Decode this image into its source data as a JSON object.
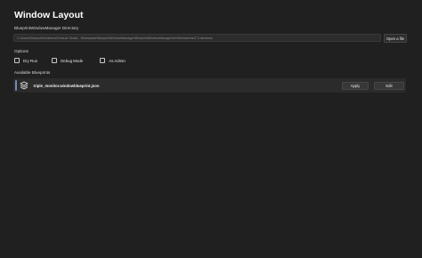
{
  "header": {
    "title": "Window Layout"
  },
  "directory": {
    "label": "BlueprintWindowManager Directory",
    "path": "C:\\Users\\Shauna\\Workbench\\Visual Studio - Workspace\\BlueprintWindowManager\\BlueprintWindowManager\\bin\\Release\\net7.0-windows",
    "open_button_label": "Open a file"
  },
  "options": {
    "label": "Options",
    "items": [
      {
        "label": "Dry Run",
        "checked": false
      },
      {
        "label": "Debug Mode",
        "checked": false
      },
      {
        "label": "As Admin",
        "checked": false
      }
    ]
  },
  "blueprints": {
    "label": "Available Blueprints",
    "items": [
      {
        "name": "triple_monitor.windowblueprint.json",
        "icon": "layers-icon",
        "apply_label": "Apply",
        "edit_label": "Edit"
      }
    ]
  },
  "colors": {
    "background": "#202020",
    "card": "#2b2b2b",
    "accent": "#6b8fb8"
  }
}
